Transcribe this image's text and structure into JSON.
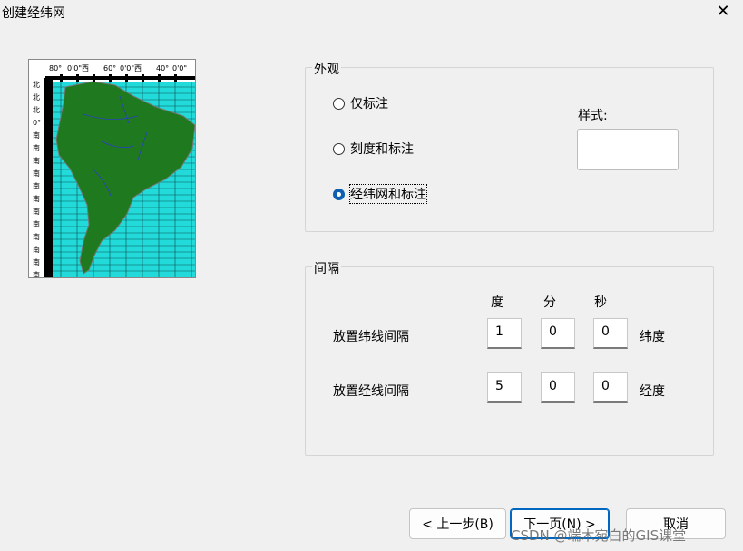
{
  "window": {
    "title": "创建经纬网",
    "close_glyph": "✕"
  },
  "preview": {
    "top_labels": [
      "80°",
      "0'0\"西",
      "60°",
      "0'0\"西",
      "40°",
      "0'0\""
    ],
    "side_labels": [
      "北",
      "北",
      "北",
      "0°",
      "南",
      "南",
      "南",
      "南",
      "南",
      "南",
      "南",
      "南",
      "南",
      "南",
      "南",
      "南"
    ]
  },
  "appearance": {
    "group_label": "外观",
    "options": [
      {
        "label": "仅标注",
        "checked": false
      },
      {
        "label": "刻度和标注",
        "checked": false
      },
      {
        "label": "经纬网和标注",
        "checked": true
      }
    ],
    "style_label": "样式:"
  },
  "interval": {
    "group_label": "间隔",
    "headers": {
      "deg": "度",
      "min": "分",
      "sec": "秒"
    },
    "lat": {
      "label": "放置纬线间隔",
      "deg": "1",
      "min": "0",
      "sec": "0",
      "unit": "纬度"
    },
    "lon": {
      "label": "放置经线间隔",
      "deg": "5",
      "min": "0",
      "sec": "0",
      "unit": "经度"
    }
  },
  "buttons": {
    "back": "< 上一步(B)",
    "next": "下一页(N) >",
    "cancel": "取消"
  },
  "watermark": "CSDN @端木宛白的GIS课堂",
  "colors": {
    "ocean": "#22dada",
    "land": "#1f7a1f",
    "selected": "#0f5fb0"
  }
}
